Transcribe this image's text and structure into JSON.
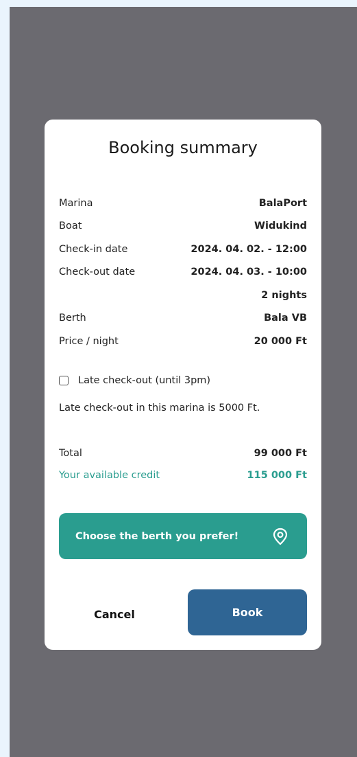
{
  "dialog": {
    "title": "Booking summary",
    "details": [
      {
        "label": "Marina",
        "value": "BalaPort"
      },
      {
        "label": "Boat",
        "value": "Widukind"
      },
      {
        "label": "Check-in date",
        "value": "2024. 04. 02. - 12:00"
      },
      {
        "label": "Check-out date",
        "value": "2024. 04. 03. - 10:00"
      },
      {
        "label": "",
        "value": "2 nights"
      },
      {
        "label": "Berth",
        "value": "Bala VB"
      },
      {
        "label": "Price / night",
        "value": "20 000 Ft"
      }
    ],
    "late_checkout": {
      "label": "Late check-out (until 3pm)",
      "checked": false,
      "note": "Late check-out in this marina is 5000 Ft."
    },
    "total": {
      "label": "Total",
      "value": "99 000 Ft"
    },
    "credit": {
      "label": "Your available credit",
      "value": "115 000 Ft"
    },
    "berth_button": {
      "label": "Choose the berth you prefer!",
      "icon": "location-pin-icon"
    },
    "cancel_label": "Cancel",
    "book_label": "Book"
  },
  "colors": {
    "accent_teal": "#2a9d8f",
    "primary_blue": "#2f6594",
    "overlay": "#6b6a70",
    "page_bg": "#eaf4fd"
  }
}
